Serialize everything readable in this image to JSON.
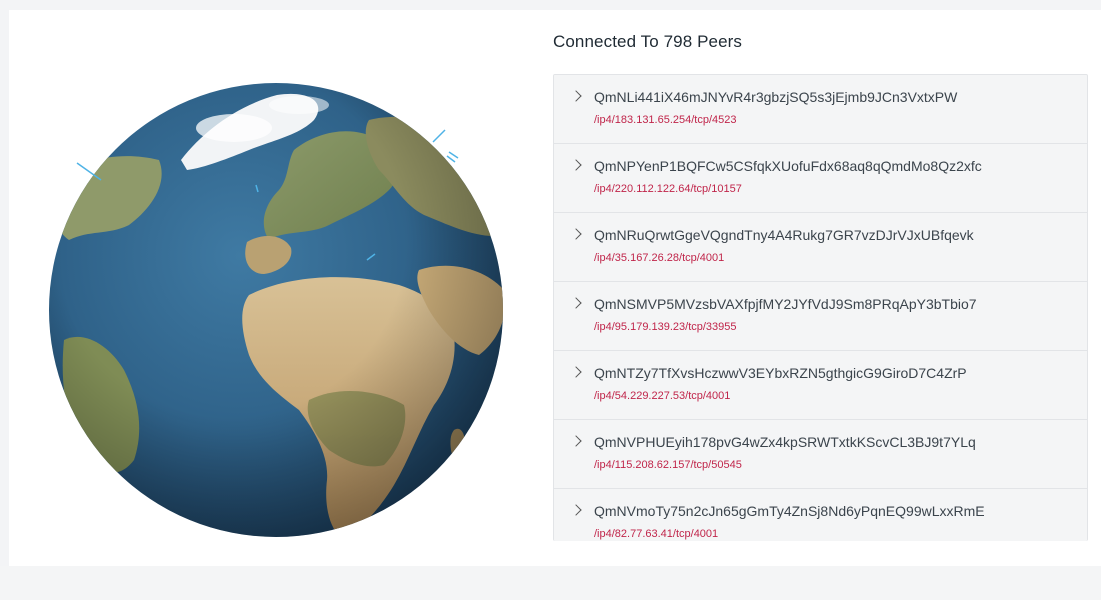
{
  "peers_panel": {
    "title": "Connected To 798 Peers",
    "peers": [
      {
        "id": "QmNLi441iX46mJNYvR4r3gbzjSQ5s3jEjmb9JCn3VxtxPW",
        "address": "/ip4/183.131.65.254/tcp/4523"
      },
      {
        "id": "QmNPYenP1BQFCw5CSfqkXUofuFdx68aq8qQmdMo8Qz2xfc",
        "address": "/ip4/220.112.122.64/tcp/10157"
      },
      {
        "id": "QmNRuQrwtGgeVQgndTny4A4Rukg7GR7vzDJrVJxUBfqevk",
        "address": "/ip4/35.167.26.28/tcp/4001"
      },
      {
        "id": "QmNSMVP5MVzsbVAXfpjfMY2JYfVdJ9Sm8PRqApY3bTbio7",
        "address": "/ip4/95.179.139.23/tcp/33955"
      },
      {
        "id": "QmNTZy7TfXvsHczwwV3EYbxRZN5gthgicG9GiroD7C4ZrP",
        "address": "/ip4/54.229.227.53/tcp/4001"
      },
      {
        "id": "QmNVPHUEyih178pvG4wZx4kpSRWTxtkKScvCL3BJ9t7YLq",
        "address": "/ip4/115.208.62.157/tcp/50545"
      },
      {
        "id": "QmNVmoTy75n2cJn65gGmTy4ZnSj8Nd6yPqnEQ99wLxxRmE",
        "address": "/ip4/82.77.63.41/tcp/4001"
      }
    ]
  },
  "colors": {
    "ocean": "#2f6289",
    "land": "#c2a574",
    "address": "#c0254a",
    "connection_line": "#4fb3e6"
  }
}
